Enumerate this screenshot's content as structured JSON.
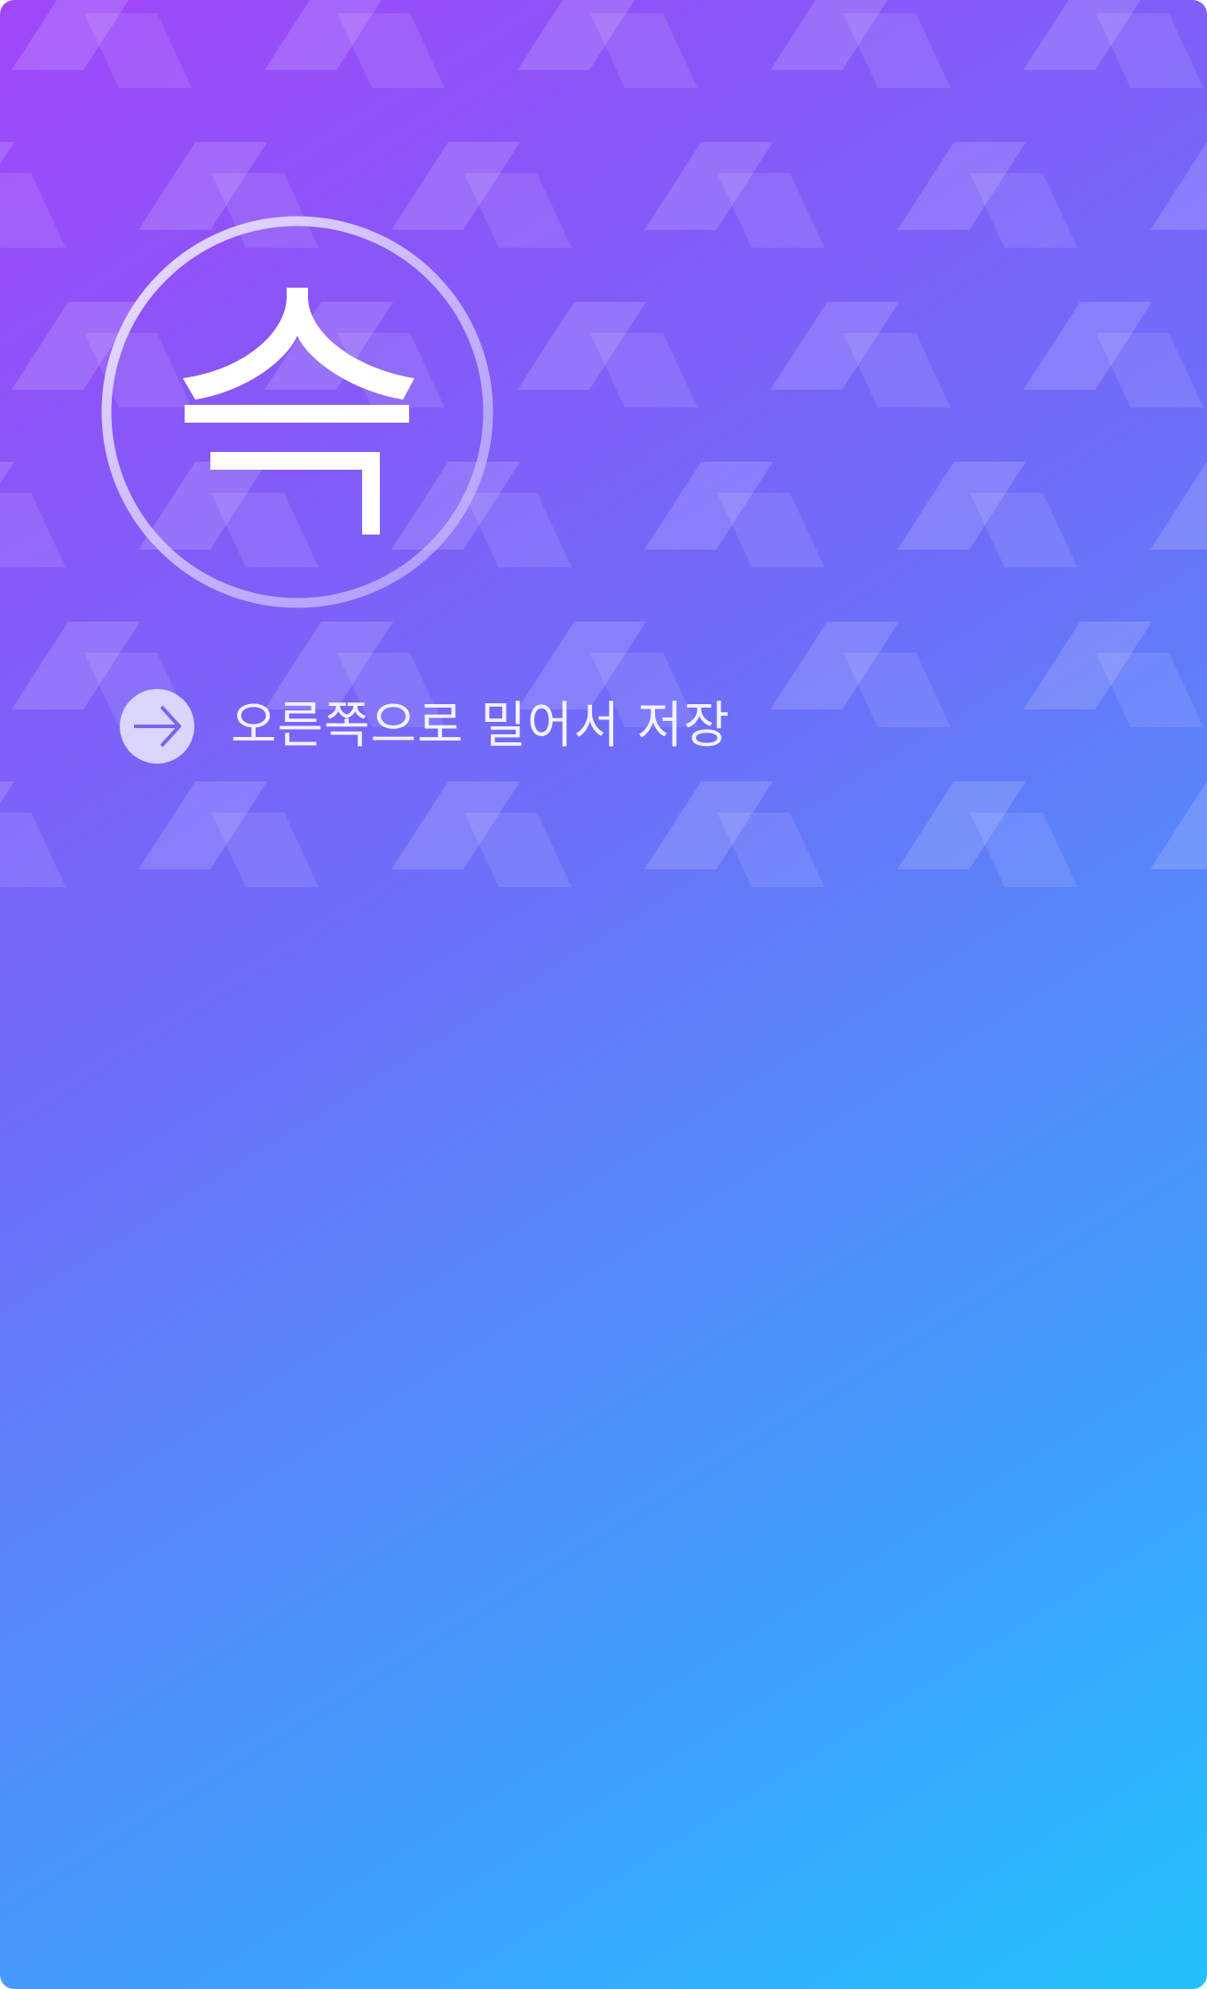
{
  "logo": {
    "glyph": "슥"
  },
  "swipe": {
    "icon": "arrow-right-icon",
    "label": "오른쪽으로 밀어서 저장"
  },
  "colors": {
    "gradient_start": "#a047f9",
    "gradient_mid": "#6e6ef9",
    "gradient_end": "#22c1fc",
    "button_bg": "#d9d5fb",
    "arrow": "#7b63f0",
    "text": "#f4f2ff"
  }
}
